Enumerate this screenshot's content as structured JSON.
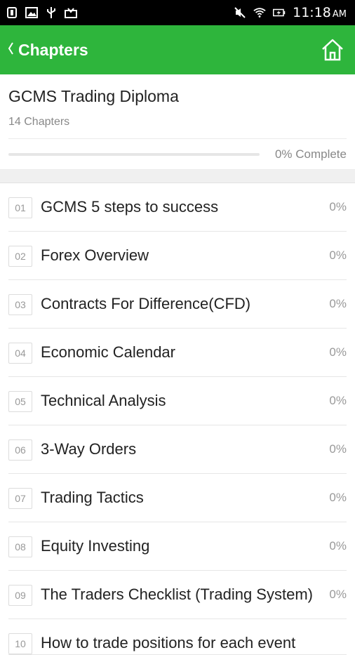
{
  "status": {
    "time": "11:18",
    "ampm": "AM"
  },
  "header": {
    "back_label": "Chapters"
  },
  "course": {
    "title": "GCMS Trading Diploma",
    "chapter_count": "14 Chapters",
    "progress_label": "0% Complete",
    "progress_fraction": 0
  },
  "chapters": [
    {
      "num": "01",
      "title": "GCMS 5 steps to success",
      "pct": "0%"
    },
    {
      "num": "02",
      "title": "Forex Overview",
      "pct": "0%"
    },
    {
      "num": "03",
      "title": "Contracts For Difference(CFD)",
      "pct": "0%"
    },
    {
      "num": "04",
      "title": "Economic Calendar",
      "pct": "0%"
    },
    {
      "num": "05",
      "title": "Technical Analysis",
      "pct": "0%"
    },
    {
      "num": "06",
      "title": "3-Way Orders",
      "pct": "0%"
    },
    {
      "num": "07",
      "title": "Trading Tactics",
      "pct": "0%"
    },
    {
      "num": "08",
      "title": "Equity Investing",
      "pct": "0%"
    },
    {
      "num": "09",
      "title": "The Traders Checklist (Trading System)",
      "pct": "0%"
    },
    {
      "num": "10",
      "title": "How to trade positions for each event",
      "pct": ""
    }
  ],
  "colors": {
    "accent": "#2eb53c",
    "statusbar": "#000000"
  },
  "icons": {
    "back": "chevron-left-icon",
    "home": "home-icon"
  }
}
